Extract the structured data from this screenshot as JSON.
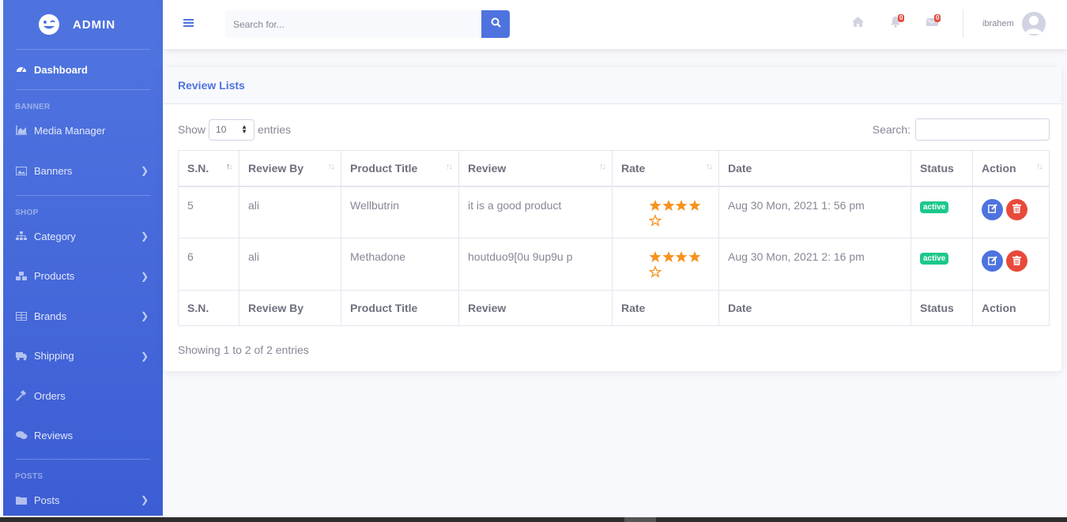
{
  "brand": {
    "title": "ADMIN"
  },
  "sidebar": {
    "dashboard": "Dashboard",
    "heading_banner": "BANNER",
    "media_manager": "Media Manager",
    "banners": "Banners",
    "heading_shop": "SHOP",
    "category": "Category",
    "products": "Products",
    "brands": "Brands",
    "shipping": "Shipping",
    "orders": "Orders",
    "reviews": "Reviews",
    "heading_posts": "POSTS",
    "posts": "Posts"
  },
  "topbar": {
    "search_placeholder": "Search for...",
    "alerts_count": "0",
    "messages_count": "0",
    "username": "ibrahem"
  },
  "card": {
    "title": "Review Lists",
    "show_label": "Show",
    "entries_value": "10",
    "entries_label": "entries",
    "search_label": "Search:",
    "info": "Showing 1 to 2 of 2 entries"
  },
  "table": {
    "columns": [
      "S.N.",
      "Review By",
      "Product Title",
      "Review",
      "Rate",
      "Date",
      "Status",
      "Action"
    ],
    "rows": [
      {
        "sn": "5",
        "review_by": "ali",
        "product": "Wellbutrin",
        "review": "it is a good product",
        "rate": 4,
        "date": "Aug 30 Mon, 2021 1: 56 pm",
        "status": "active"
      },
      {
        "sn": "6",
        "review_by": "ali",
        "product": "Methadone",
        "review": "houtduo9[0u 9up9u p",
        "rate": 4,
        "date": "Aug 30 Mon, 2021 2: 16 pm",
        "status": "active"
      }
    ]
  },
  "colors": {
    "primary": "#4e73df",
    "success": "#1cc88a",
    "danger": "#e74a3b",
    "star": "#f6921e"
  }
}
